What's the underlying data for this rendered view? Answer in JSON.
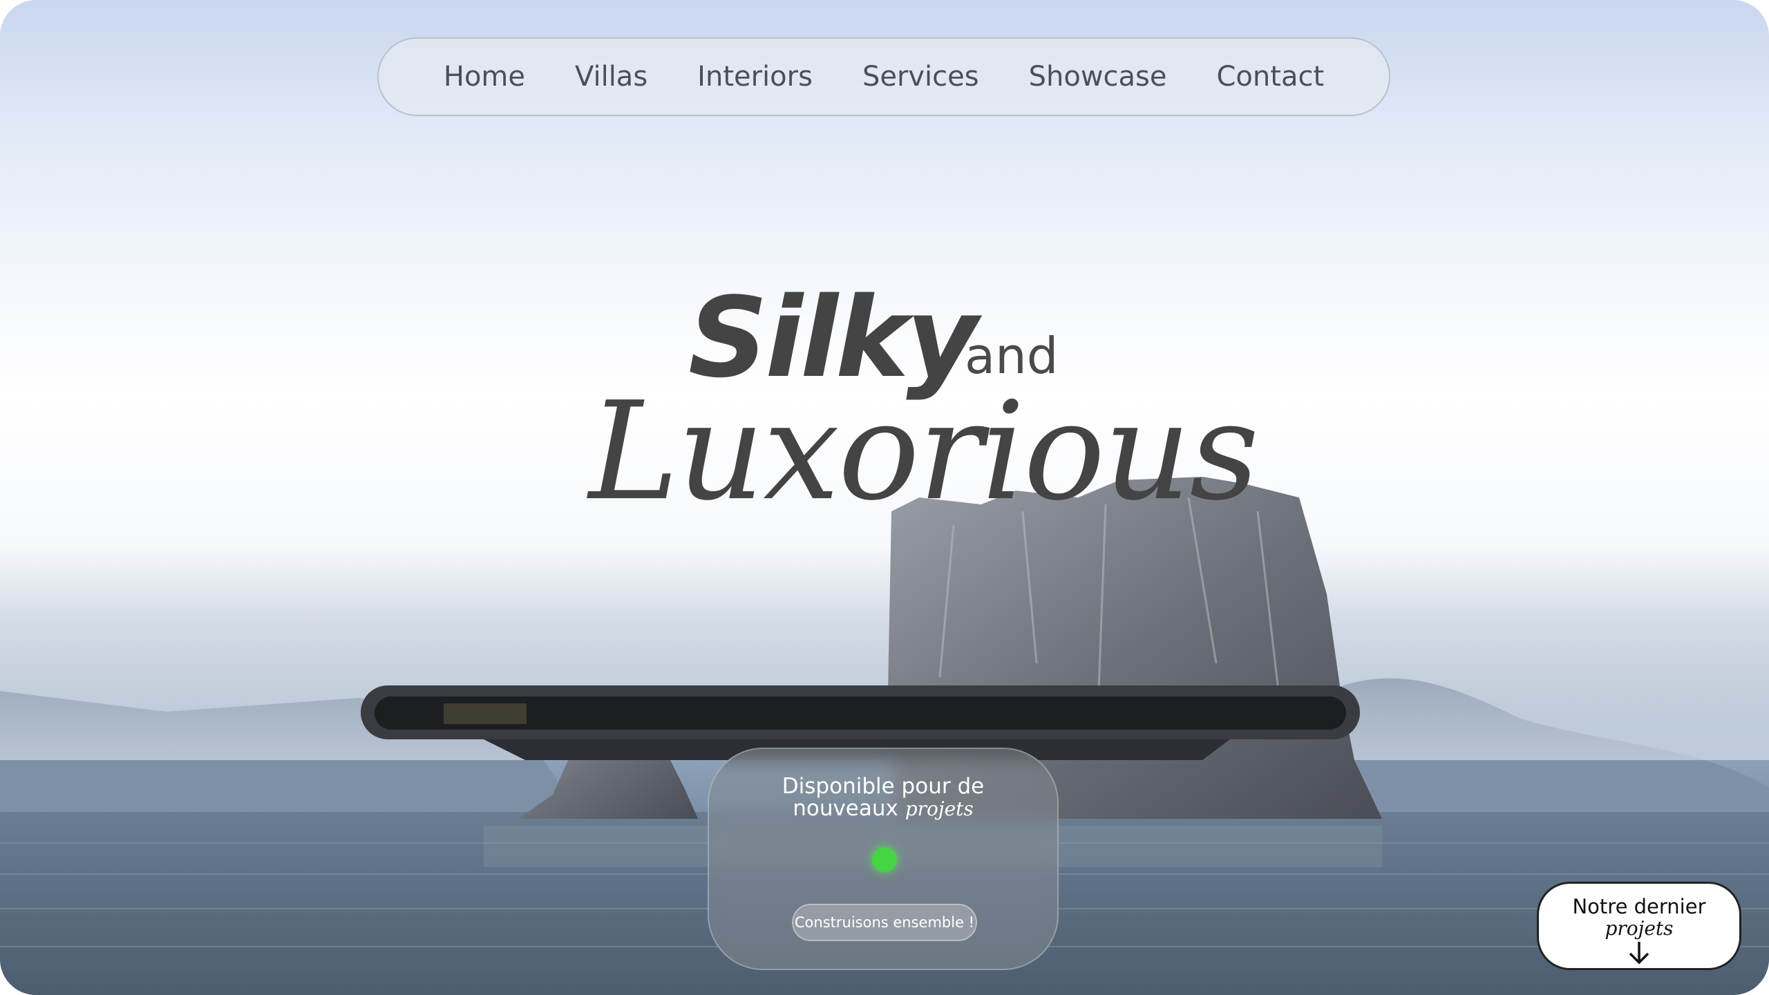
{
  "nav": {
    "items": [
      {
        "label": "Home"
      },
      {
        "label": "Villas"
      },
      {
        "label": "Interiors"
      },
      {
        "label": "Services"
      },
      {
        "label": "Showcase"
      },
      {
        "label": "Contact"
      }
    ]
  },
  "hero": {
    "word1": "Silky",
    "connector": "and",
    "word2": "Luxorious"
  },
  "availability": {
    "line1": "Disponible pour de",
    "line2": "nouveaux",
    "line2_italic": "projets",
    "status_color": "#44d444",
    "cta_label": "Construisons ensemble !"
  },
  "latest_projects": {
    "line1": "Notre dernier",
    "line2_italic": "projets",
    "icon": "arrow-down-icon"
  }
}
